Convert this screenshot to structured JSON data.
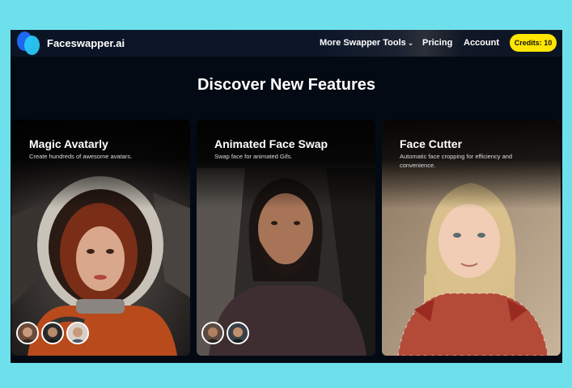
{
  "brand": {
    "name": "Faceswapper.ai"
  },
  "nav": {
    "tools_label": "More Swapper Tools",
    "pricing_label": "Pricing",
    "account_label": "Account",
    "credits_label": "Credits: 10"
  },
  "heading": "Discover New Features",
  "cards": [
    {
      "title": "Magic Avatarly",
      "description": "Create hundreds of awesome avatars."
    },
    {
      "title": "Animated Face Swap",
      "description": "Swap face for animated Gifs."
    },
    {
      "title": "Face Cutter",
      "description": "Automatic face cropping for efficiency and convenience."
    }
  ],
  "colors": {
    "accent": "#ffe600",
    "page_bg": "#030a14",
    "outer_bg": "#6ee0eb",
    "logo_blue": "#1e67f0",
    "logo_cyan": "#29c7f4"
  },
  "icons": [
    "logo-icon",
    "chevron-down-icon"
  ]
}
